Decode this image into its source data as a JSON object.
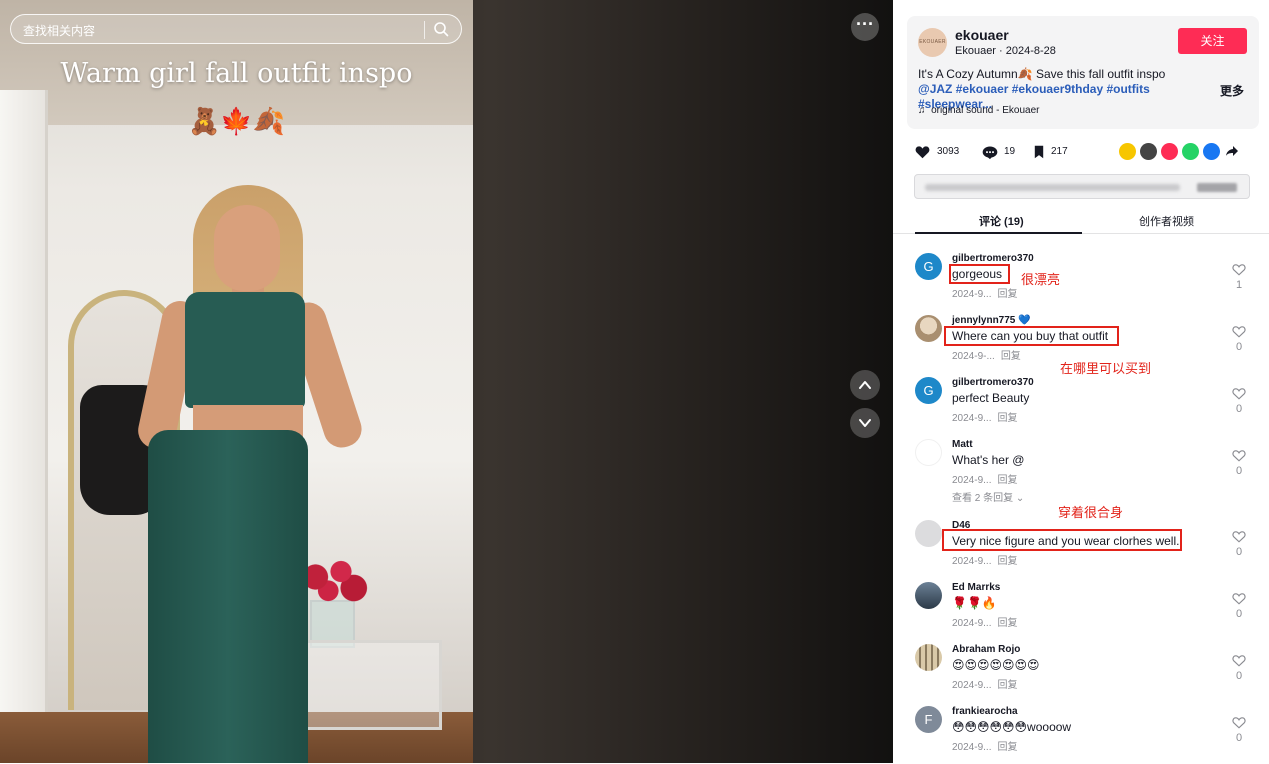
{
  "search": {
    "placeholder": "查找相关内容"
  },
  "video": {
    "title": "Warm girl fall outfit inspo",
    "emojis": "🧸🍁🍂",
    "more_label": "···"
  },
  "author": {
    "avatar_text": "EKOUAER",
    "name": "ekouaer",
    "sub": "Ekouaer · 2024-8-28",
    "follow_label": "关注"
  },
  "description": {
    "text": "It's A Cozy Autumn🍂 Save this fall outfit inspo",
    "mention": "@JAZ",
    "tags": "#ekouaer #ekouaer9thday #outfits #sleepwear...",
    "more_label": "更多"
  },
  "music": {
    "icon": "music-note-icon",
    "text": "original sound - Ekouaer"
  },
  "stats": {
    "likes": "3093",
    "comments": "19",
    "saves": "217"
  },
  "tabs": {
    "comments_label": "评论 (19)",
    "creator_videos_label": "创作者视频"
  },
  "comments": [
    {
      "user": "gilbertromero370",
      "avatar": "G",
      "avatar_color": "#1e88c9",
      "text": "gorgeous",
      "time": "2024-9...",
      "reply": "回复",
      "likes": "1"
    },
    {
      "user": "jennylynn775 💙",
      "avatar": "",
      "avatar_color": "#c8b49a",
      "text": "Where can you buy that outfit",
      "time": "2024-9-...",
      "reply": "回复",
      "likes": "0"
    },
    {
      "user": "gilbertromero370",
      "avatar": "G",
      "avatar_color": "#1e88c9",
      "text": "perfect Beauty",
      "time": "2024-9...",
      "reply": "回复",
      "likes": "0"
    },
    {
      "user": "Matt",
      "avatar": "",
      "avatar_color": "#ffffff",
      "text": "What's her @",
      "time": "2024-9...",
      "reply": "回复",
      "likes": "0",
      "view_replies": "查看 2 条回复 ⌄"
    },
    {
      "user": "D46",
      "avatar": "",
      "avatar_color": "#d8d8da",
      "text": "Very nice figure and you wear clorhes well.",
      "time": "2024-9...",
      "reply": "回复",
      "likes": "0"
    },
    {
      "user": "Ed Marrks",
      "avatar": "",
      "avatar_color": "#3c4b5a",
      "text": "🌹🌹🔥",
      "time": "2024-9...",
      "reply": "回复",
      "likes": "0"
    },
    {
      "user": "Abraham Rojo",
      "avatar": "",
      "avatar_color": "#d9c9a8",
      "text": "😍😍😍😍😍😍😍",
      "time": "2024-9...",
      "reply": "回复",
      "likes": "0"
    },
    {
      "user": "frankiearocha",
      "avatar": "F",
      "avatar_color": "#7f8a99",
      "text": "😳😳😳😳😳😳woooow",
      "time": "2024-9...",
      "reply": "回复",
      "likes": "0"
    }
  ],
  "annotations": {
    "a1": "很漂亮",
    "a2": "在哪里可以买到",
    "a3": "穿着很合身"
  },
  "colors": {
    "accent": "#fe2c55",
    "annotation": "#e2231a",
    "link": "#2b5db9"
  }
}
